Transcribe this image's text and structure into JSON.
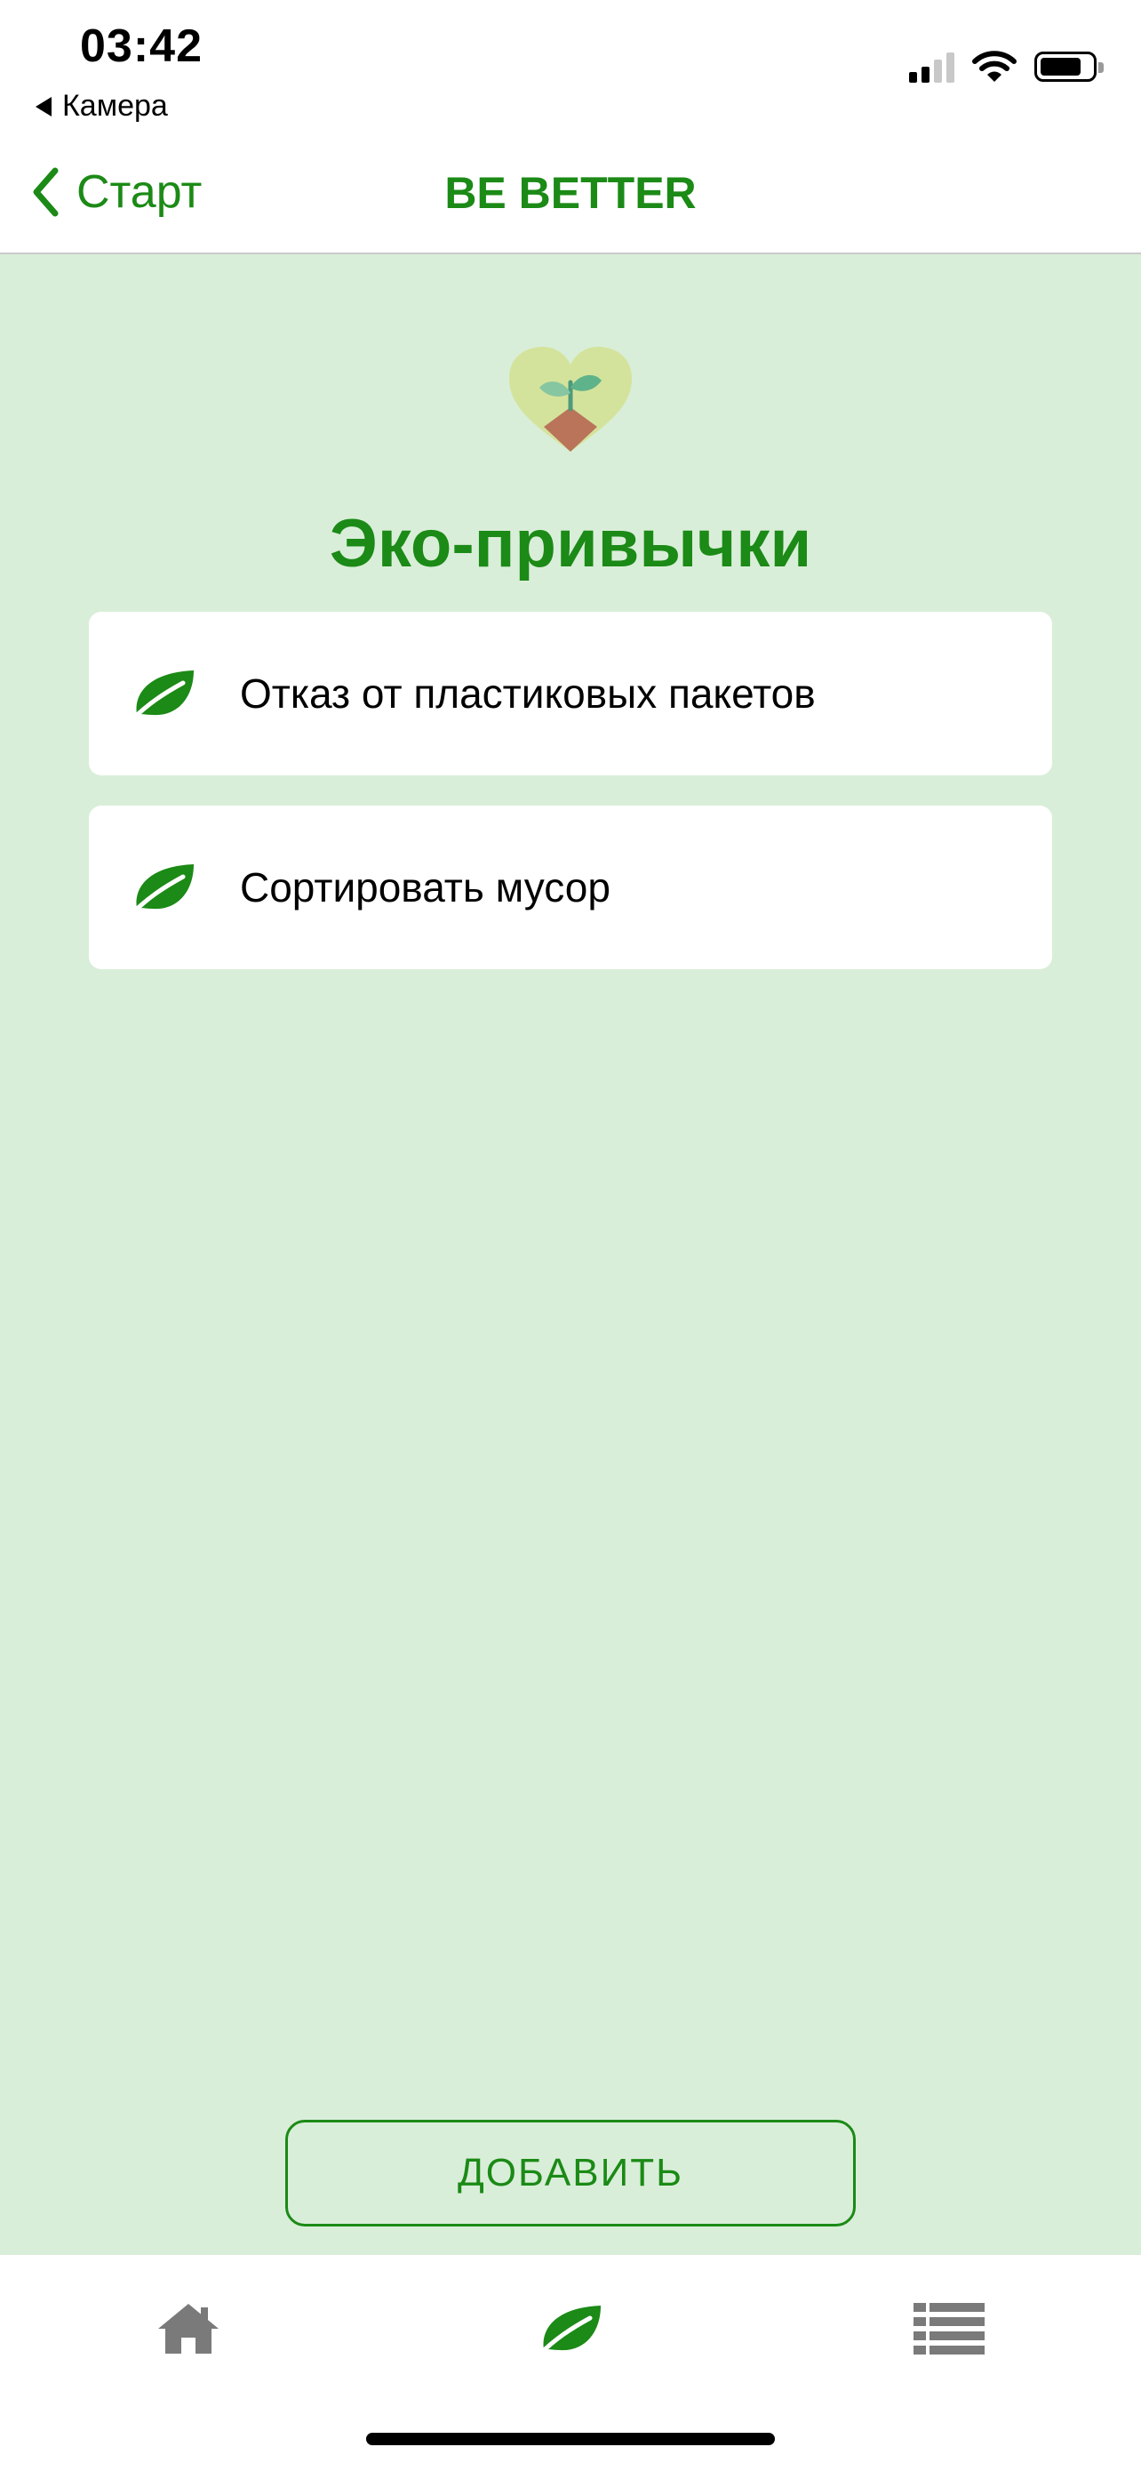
{
  "status_bar": {
    "time": "03:42",
    "back_app_label": "Камера"
  },
  "nav": {
    "back_label": "Старт",
    "title": "BE BETTER"
  },
  "section": {
    "title": "Эко-привычки"
  },
  "habits": [
    {
      "label": "Отказ от пластиковых пакетов",
      "icon": "leaf-icon"
    },
    {
      "label": "Сортировать мусор",
      "icon": "leaf-icon"
    }
  ],
  "actions": {
    "add_label": "ДОБАВИТЬ"
  },
  "tabs": [
    {
      "icon": "home-icon",
      "active": false
    },
    {
      "icon": "leaf-icon",
      "active": true
    },
    {
      "icon": "list-icon",
      "active": false
    }
  ],
  "colors": {
    "accent": "#1b8a16",
    "background": "#d9eed9",
    "card": "#ffffff",
    "inactive_icon": "#7a7a7a"
  }
}
